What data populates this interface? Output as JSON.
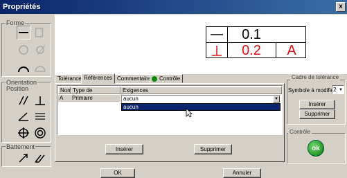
{
  "window": {
    "title": "Propriétés",
    "close_label": "x"
  },
  "groups": {
    "forme": "Forme",
    "orientation": "Orientation",
    "position": "Position",
    "battement": "Battement"
  },
  "tools": [
    "straightness-icon",
    "flatness-icon",
    "circularity-icon",
    "cylindricity-icon",
    "line-profile-icon",
    "surface-profile-icon",
    "parallelism-icon",
    "perpendicularity-icon",
    "angularity-icon",
    "symmetry-icon",
    "position-icon",
    "concentricity-icon",
    "circular-runout-icon",
    "total-runout-icon"
  ],
  "preview": {
    "row1": {
      "value": "0.1"
    },
    "row2": {
      "value": "0.2",
      "datum": "A"
    },
    "accent": "#e01010"
  },
  "tabs": [
    "Tolérance",
    "Références",
    "Commentaires",
    "Contrôle"
  ],
  "active_tab": "Références",
  "grid": {
    "headers": [
      "Nom",
      "Type de références",
      "Exigences"
    ],
    "rows": [
      {
        "nom": "A",
        "type": "Primaire",
        "exigence": "aucun"
      }
    ]
  },
  "combo": {
    "value": "aucun",
    "option": "aucun"
  },
  "buttons": {
    "inserer": "Insérer",
    "supprimer": "Supprimer",
    "ok": "OK",
    "annuler": "Annuler"
  },
  "cadre": {
    "title": "Cadre de tolérance",
    "symbole_label": "Symbole à modifier",
    "symbole_value": "2",
    "inserer": "Insérer",
    "supprimer": "Supprimer"
  },
  "controle": {
    "title": "Contrôle",
    "ok_icon_label": "ok"
  }
}
